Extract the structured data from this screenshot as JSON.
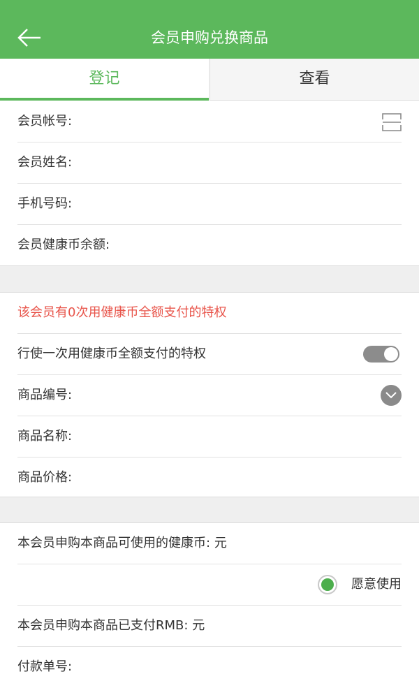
{
  "header": {
    "title": "会员申购兑换商品",
    "back_icon": "arrow-left-icon",
    "background_color": "#5cb85c"
  },
  "tabs": [
    {
      "label": "登记",
      "active": true
    },
    {
      "label": "查看",
      "active": false
    }
  ],
  "member_section": {
    "account_label": "会员帐号:",
    "account_value": "",
    "scan_icon": "scan-icon",
    "name_label": "会员姓名:",
    "name_value": "",
    "phone_label": "手机号码:",
    "phone_value": "",
    "balance_label": "会员健康币余额:",
    "balance_value": ""
  },
  "product_section": {
    "privilege_notice": "该会员有0次用健康币全额支付的特权",
    "privilege_notice_color": "#e8544a",
    "use_privilege_label": "行使一次用健康币全额支付的特权",
    "use_privilege_toggle_on": true,
    "product_code_label": "商品编号:",
    "product_code_value": "",
    "dropdown_icon": "chevron-down-icon",
    "product_name_label": "商品名称:",
    "product_name_value": "",
    "product_price_label": "商品价格:",
    "product_price_value": ""
  },
  "payment_section": {
    "usable_coin_label": "本会员申购本商品可使用的健康币:",
    "usable_coin_unit": "元",
    "willing_label": "愿意使用",
    "willing_selected": true,
    "paid_rmb_label": "本会员申购本商品已支付RMB:",
    "paid_rmb_unit": "元",
    "payment_no_label": "付款单号:"
  }
}
